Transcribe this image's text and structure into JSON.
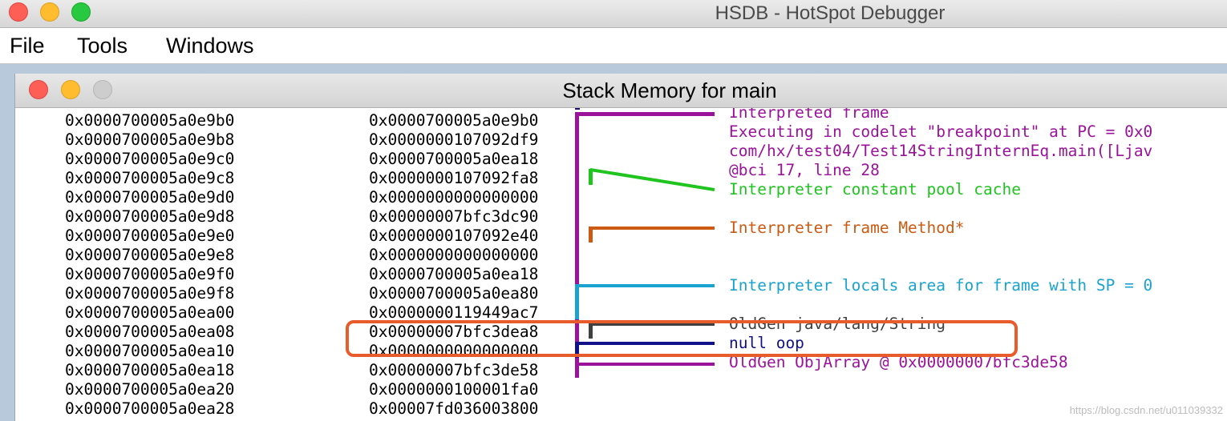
{
  "app": {
    "title": "HSDB - HotSpot Debugger"
  },
  "menu": {
    "file": "File",
    "tools": "Tools",
    "windows": "Windows"
  },
  "window": {
    "title": "Stack Memory for main"
  },
  "rows": [
    {
      "addr": "0x0000700005a0e9b0",
      "val": "0x0000700005a0e9b0"
    },
    {
      "addr": "0x0000700005a0e9b8",
      "val": "0x0000000107092df9"
    },
    {
      "addr": "0x0000700005a0e9c0",
      "val": "0x0000700005a0ea18"
    },
    {
      "addr": "0x0000700005a0e9c8",
      "val": "0x0000000107092fa8"
    },
    {
      "addr": "0x0000700005a0e9d0",
      "val": "0x0000000000000000"
    },
    {
      "addr": "0x0000700005a0e9d8",
      "val": "0x00000007bfc3dc90"
    },
    {
      "addr": "0x0000700005a0e9e0",
      "val": "0x0000000107092e40"
    },
    {
      "addr": "0x0000700005a0e9e8",
      "val": "0x0000000000000000"
    },
    {
      "addr": "0x0000700005a0e9f0",
      "val": "0x0000700005a0ea18"
    },
    {
      "addr": "0x0000700005a0e9f8",
      "val": "0x0000700005a0ea80"
    },
    {
      "addr": "0x0000700005a0ea00",
      "val": "0x0000000119449ac7"
    },
    {
      "addr": "0x0000700005a0ea08",
      "val": "0x00000007bfc3dea8"
    },
    {
      "addr": "0x0000700005a0ea10",
      "val": "0x0000000000000000"
    },
    {
      "addr": "0x0000700005a0ea18",
      "val": "0x00000007bfc3de58"
    },
    {
      "addr": "0x0000700005a0ea20",
      "val": "0x0000000100001fa0"
    },
    {
      "addr": "0x0000700005a0ea28",
      "val": "0x00007fd036003800"
    }
  ],
  "annotations": [
    {
      "text": "Interpreted frame",
      "color": "#9a139a"
    },
    {
      "text": "Executing in codelet \"breakpoint\" at PC = 0x0",
      "color": "#9a139a"
    },
    {
      "text": "com/hx/test04/Test14StringInternEq.main([Ljav",
      "color": "#9a139a"
    },
    {
      "text": "@bci 17, line 28",
      "color": "#9a139a"
    },
    {
      "text": "Interpreter constant pool cache",
      "color": "#1fc41f"
    },
    {
      "text": "Interpreter frame Method*",
      "color": "#cc5a12"
    },
    {
      "text": "Interpreter locals area for frame with SP = 0",
      "color": "#1aa3d0"
    },
    {
      "text": "OldGen java/lang/String",
      "color": "#404040"
    },
    {
      "text": "null oop",
      "color": "#11118a"
    },
    {
      "text": "OldGen ObjArray @ 0x00000007bfc3de58",
      "color": "#9a139a"
    }
  ],
  "watermark": "https://blog.csdn.net/u011039332"
}
